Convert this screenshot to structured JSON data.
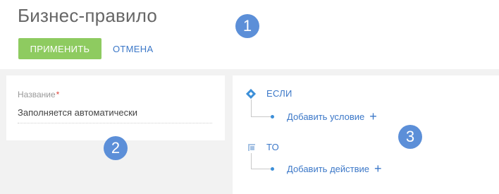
{
  "header": {
    "title": "Бизнес-правило",
    "watermark": "",
    "apply_label": "ПРИМЕНИТЬ",
    "cancel_label": "ОТМЕНА"
  },
  "callouts": [
    "1",
    "2",
    "3"
  ],
  "form": {
    "name_label": "Название",
    "required_mark": "*",
    "name_value": "Заполняется автоматически"
  },
  "rules": {
    "if_label": "ЕСЛИ",
    "add_condition_label": "Добавить условие",
    "then_label": "ТО",
    "add_action_label": "Добавить действие",
    "plus_symbol": "+"
  },
  "colors": {
    "apply_button": "#8ecb60",
    "link": "#3c78c8",
    "callout": "#5c8fd8",
    "required": "#e0453a"
  },
  "icons": {
    "if": "diamond-icon",
    "then": "square-icon",
    "add": "plus-icon"
  }
}
